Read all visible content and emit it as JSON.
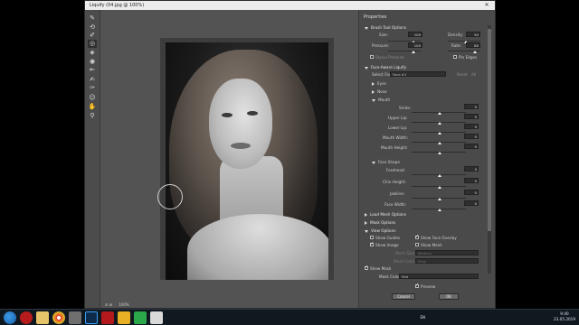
{
  "window": {
    "title": "Liquify (04.jpg @ 100%)",
    "close_glyph": "✕"
  },
  "tools": [
    "forward-warp",
    "reconstruct",
    "smooth",
    "twirl",
    "pucker",
    "bloat",
    "push-left",
    "freeze-mask",
    "thaw-mask",
    "face",
    "hand",
    "zoom"
  ],
  "canvas": {
    "zoom": "100%"
  },
  "properties": {
    "title": "Properties",
    "brush_tool_options": {
      "label": "Brush Tool Options",
      "size": {
        "label": "Size:",
        "value": "100"
      },
      "density": {
        "label": "Density:",
        "value": "50"
      },
      "pressure": {
        "label": "Pressure:",
        "value": "100"
      },
      "rate": {
        "label": "Rate:",
        "value": "80"
      },
      "stylus_pressure": "Stylus Pressure",
      "pin_edges": "Pin Edges"
    },
    "face_aware": {
      "label": "Face-Aware Liquify",
      "select_face_label": "Select Face:",
      "select_face_value": "Face #1",
      "reset": "Reset",
      "all": "All",
      "groups": [
        "Eyes",
        "Nose"
      ],
      "mouth": {
        "label": "Mouth",
        "sliders": [
          {
            "label": "Smile:",
            "value": "0"
          },
          {
            "label": "Upper Lip:",
            "value": "0"
          },
          {
            "label": "Lower Lip:",
            "value": "0"
          },
          {
            "label": "Mouth Width:",
            "value": "0"
          },
          {
            "label": "Mouth Height:",
            "value": "0"
          }
        ]
      },
      "face_shape": {
        "label": "Face Shape",
        "sliders": [
          {
            "label": "Forehead:",
            "value": "0"
          },
          {
            "label": "Chin Height:",
            "value": "0"
          },
          {
            "label": "Jawline:",
            "value": "0"
          },
          {
            "label": "Face Width:",
            "value": "0"
          }
        ]
      }
    },
    "load_mesh": "Load Mesh Options",
    "mask_options": "Mask Options",
    "view_options": {
      "label": "View Options",
      "show_guides": "Show Guides",
      "show_face_overlay": "Show Face Overlay",
      "show_image": "Show Image",
      "show_mesh": "Show Mesh",
      "mesh_size_label": "Mesh Size:",
      "mesh_size_value": "Medium",
      "mesh_color_label": "Mesh Color:",
      "mesh_color_value": "Gray"
    },
    "show_mask": "Show Mask",
    "mask_color_label": "Mask Color:",
    "mask_color_value": "Red",
    "preview": "Preview",
    "cancel": "Cancel",
    "ok": "OK"
  },
  "taskbar": {
    "lang": "EN",
    "time": "9:40",
    "date": "23.05.2019",
    "colors": {
      "bg": "#101820",
      "photoshop": "#0e2a4a",
      "acrobat": "#b3191d",
      "chrome": "#e8b024",
      "camtasia": "#2aa84a"
    }
  }
}
